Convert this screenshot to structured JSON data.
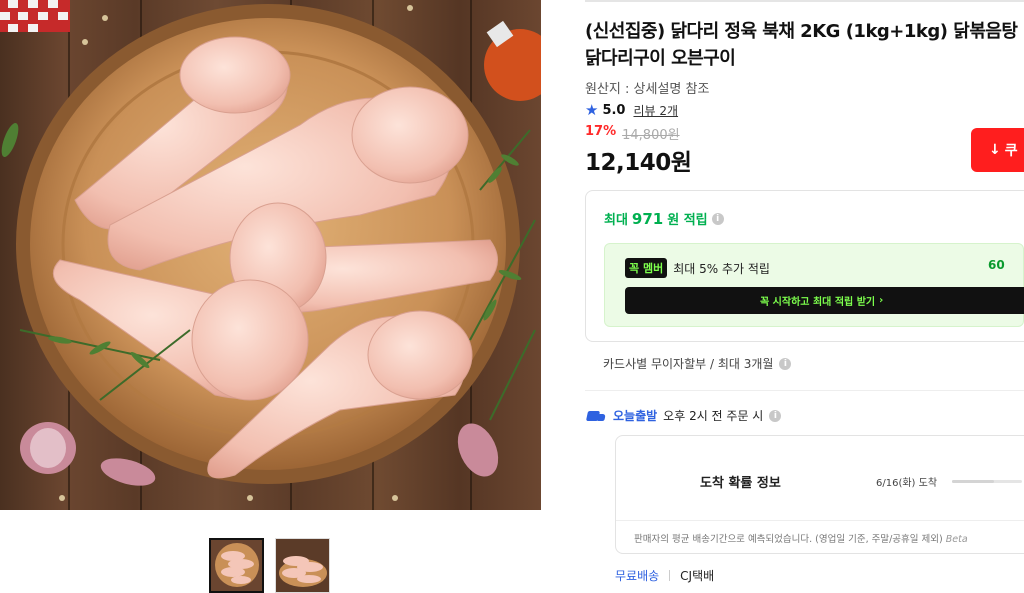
{
  "product": {
    "title": "(신선집중) 닭다리 정육 북채 2KG (1kg+1kg) 닭볶음탕 닭다리구이 오븐구이",
    "origin": "원산지 : 상세설명 참조",
    "rating": "5.0",
    "review_link": "리뷰 2개",
    "discount_rate": "17%",
    "original_price": "14,800원",
    "sale_price": "12,140원",
    "coupon_label": "쿠"
  },
  "benefits": {
    "points_prefix": "최대",
    "points_amount": "971",
    "points_suffix": "원 적립",
    "member_badge": "꼭 멤버",
    "member_text": "최대 5% 추가 적립",
    "member_amount": "60",
    "member_cta": "꼭 시작하고 최대 적립 받기",
    "installment": "카드사별 무이자할부 / 최대 3개월"
  },
  "delivery": {
    "today_label": "오늘출발",
    "cutoff": "오후 2시 전 주문 시",
    "arrival_title": "도착 확률 정보",
    "arrival_date": "6/16(화) 도착",
    "arrival_note": "판매자의 평균 배송기간으로 예측되었습니다. (영업일 기준, 주말/공휴일 제외)",
    "beta": "Beta",
    "free_shipping": "무료배송",
    "courier": "CJ택배"
  },
  "icons": {
    "star": "star-icon",
    "info": "info-icon",
    "download": "download-icon",
    "chevron": "chevron-right-icon",
    "truck": "truck-icon"
  },
  "colors": {
    "accent_blue": "#2f62e0",
    "discount_red": "#ff2a2a",
    "coupon_red": "#ff1e1e",
    "points_green": "#00b050",
    "member_neon": "#7dff4d"
  }
}
